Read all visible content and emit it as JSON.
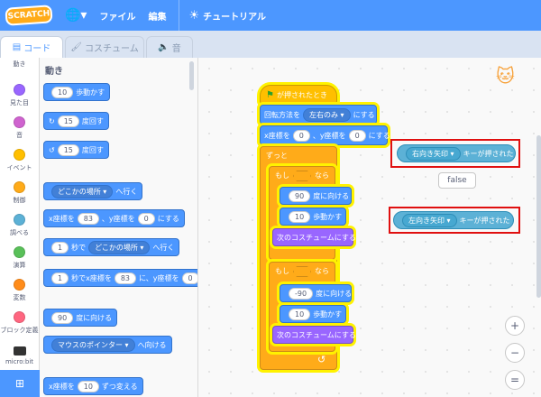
{
  "topbar": {
    "logo": "SCRATCH",
    "file": "ファイル",
    "edit": "編集",
    "tutorials": "チュートリアル"
  },
  "tabs": {
    "code": "コード",
    "costumes": "コスチューム",
    "sounds": "音"
  },
  "categories": [
    {
      "label": "動き",
      "color": "#4c97ff"
    },
    {
      "label": "見た目",
      "color": "#9966ff"
    },
    {
      "label": "音",
      "color": "#cf63cf"
    },
    {
      "label": "イベント",
      "color": "#ffbf00"
    },
    {
      "label": "制御",
      "color": "#ffab19"
    },
    {
      "label": "調べる",
      "color": "#5cb1d6"
    },
    {
      "label": "演算",
      "color": "#59c059"
    },
    {
      "label": "変数",
      "color": "#ff8c1a"
    },
    {
      "label": "ブロック定義",
      "color": "#ff6680"
    },
    {
      "label": "micro:bit",
      "color": "#0fbd8c"
    }
  ],
  "palette": {
    "title": "動き",
    "move_steps": {
      "value": "10",
      "text": "歩動かす"
    },
    "turn_right": {
      "value": "15",
      "text": "度回す"
    },
    "turn_left": {
      "value": "15",
      "text": "度回す"
    },
    "goto": {
      "dropdown": "どこかの場所",
      "text": "へ行く"
    },
    "goto_xy": {
      "x_label": "x座標を",
      "x": "83",
      "y_label": "、y座標を",
      "y": "0",
      "text": "にする"
    },
    "glide": {
      "value": "1",
      "sec": "秒で",
      "dropdown": "どこかの場所",
      "text": "へ行く"
    },
    "glide_xy": {
      "value": "1",
      "sec": "秒でx座標を",
      "x": "83",
      "mid": "に、y座標を",
      "y": "0"
    },
    "point_direction": {
      "value": "90",
      "text": "度に向ける"
    },
    "point_towards": {
      "dropdown": "マウスのポインター",
      "text": "へ向ける"
    },
    "change_x": {
      "label": "x座標を",
      "value": "10",
      "text": "ずつ変える"
    }
  },
  "script": {
    "hat": "が押されたとき",
    "rotation_label": "回転方法を",
    "rotation_value": "左右のみ",
    "rotation_text": "にする",
    "goto_x_label": "x座標を",
    "goto_x": "0",
    "goto_y_label": "、y座標を",
    "goto_y": "0",
    "goto_text": "にする",
    "forever": "ずっと",
    "if1_label": "もし",
    "if1_then": "なら",
    "if1_dir": "90",
    "if1_dir_text": "度に向ける",
    "if1_move": "10",
    "if1_move_text": "歩動かす",
    "if1_costume": "次のコスチュームにする",
    "if2_label": "もし",
    "if2_then": "なら",
    "if2_dir": "-90",
    "if2_dir_text": "度に向ける",
    "if2_move": "10",
    "if2_move_text": "歩動かす",
    "if2_costume": "次のコスチュームにする"
  },
  "sensing": {
    "right_key": "右向き矢印",
    "right_text": "キーが押された",
    "tooltip": "false",
    "left_key": "左向き矢印",
    "left_text": "キーが押された"
  },
  "zoom": {
    "in": "+",
    "out": "−",
    "reset": "="
  }
}
